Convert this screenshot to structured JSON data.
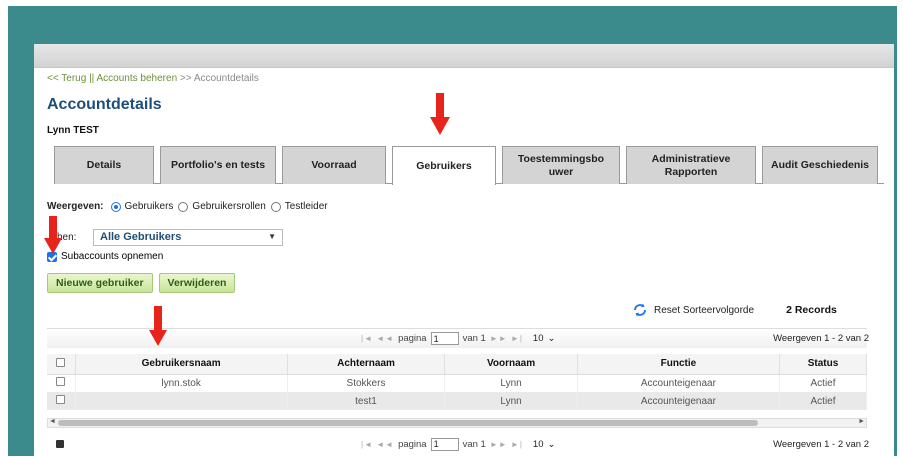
{
  "breadcrumb": {
    "back": "<< Terug",
    "sep1": "||",
    "accounts": "Accounts beheren",
    "sep2": ">>",
    "current": "Accountdetails"
  },
  "page_title": "Accountdetails",
  "account_name": "Lynn TEST",
  "tabs": [
    {
      "label": "Details"
    },
    {
      "label": "Portfolio's en tests"
    },
    {
      "label": "Voorraad"
    },
    {
      "label": "Gebruikers",
      "active": true
    },
    {
      "label": "Toestemmingsbo uwer"
    },
    {
      "label": "Administratieve Rapporten"
    },
    {
      "label": "Audit Geschiedenis"
    }
  ],
  "view": {
    "label": "Weergeven:",
    "options": [
      "Gebruikers",
      "Gebruikersrollen",
      "Testleider"
    ],
    "selected": "Gebruikers"
  },
  "filter": {
    "label": "hen:",
    "value": "Alle Gebruikers"
  },
  "subaccounts": {
    "label": "Subaccounts opnemen",
    "checked": true
  },
  "buttons": {
    "new_user": "Nieuwe gebruiker",
    "delete": "Verwijderen"
  },
  "toolbar": {
    "reset_sort": "Reset Sorteervolgorde",
    "records": "2 Records"
  },
  "pager": {
    "page_label": "pagina",
    "page_value": "1",
    "of_label": "van 1",
    "rows_value": "10",
    "view_text": "Weergeven 1 - 2 van 2"
  },
  "table": {
    "columns": [
      "Gebruikersnaam",
      "Achternaam",
      "Voornaam",
      "Functie",
      "Status"
    ],
    "rows": [
      [
        "lynn.stok",
        "Stokkers",
        "Lynn",
        "Accounteigenaar",
        "Actief"
      ],
      [
        "",
        "test1",
        "Lynn",
        "Accounteigenaar",
        "Actief"
      ]
    ]
  },
  "colors": {
    "frame": "#3b8b8d",
    "title": "#1f4e79",
    "breadcrumb": "#6d8f3a",
    "button_green": "#c8e59a",
    "arrow_red": "#e8231b"
  }
}
